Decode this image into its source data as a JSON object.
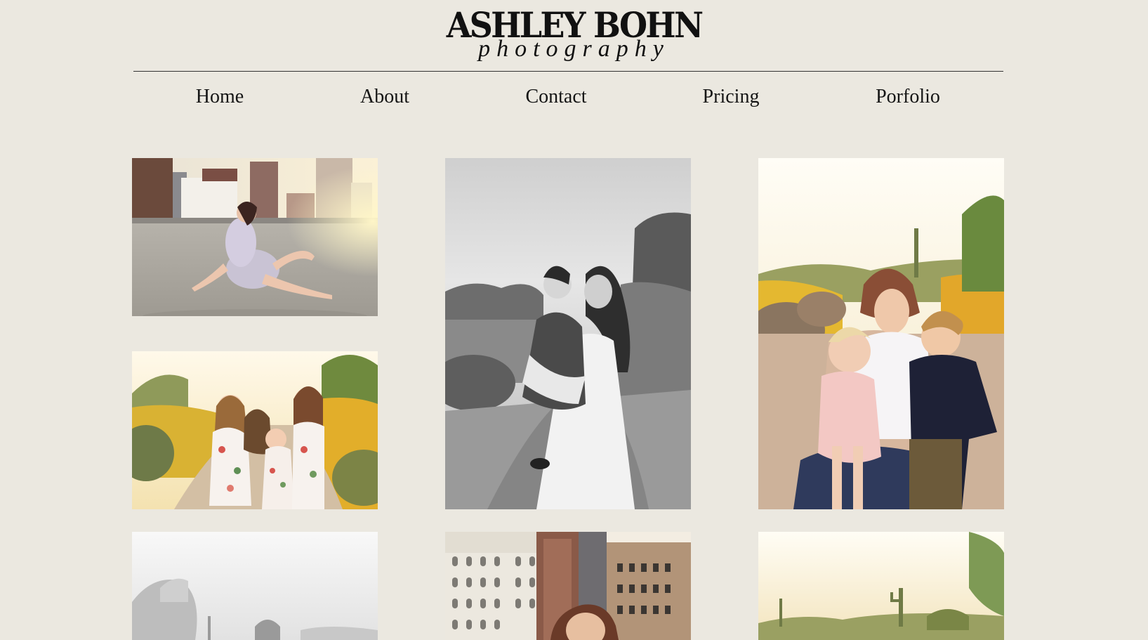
{
  "header": {
    "logo_name": "ASHLEY BOHN",
    "logo_tagline": "photography"
  },
  "nav": {
    "items": [
      {
        "label": "Home"
      },
      {
        "label": "About"
      },
      {
        "label": "Contact"
      },
      {
        "label": "Pricing"
      },
      {
        "label": "Porfolio"
      }
    ]
  },
  "gallery": {
    "photos": [
      {
        "subject": "woman sitting on rooftop at sunset with city skyline",
        "tone": "color"
      },
      {
        "subject": "mother and daughter embracing in desert",
        "tone": "black-and-white"
      },
      {
        "subject": "mother with two young children on desert trail",
        "tone": "color"
      },
      {
        "subject": "mother with three daughters in floral dresses in desert",
        "tone": "color"
      },
      {
        "subject": "woman in desert landscape",
        "tone": "black-and-white"
      },
      {
        "subject": "woman portrait in front of city buildings",
        "tone": "color"
      },
      {
        "subject": "desert landscape at sunset with saguaro",
        "tone": "color"
      }
    ]
  },
  "colors": {
    "background": "#ebe8e0",
    "text": "#1a1a1a",
    "divider": "#333333"
  }
}
